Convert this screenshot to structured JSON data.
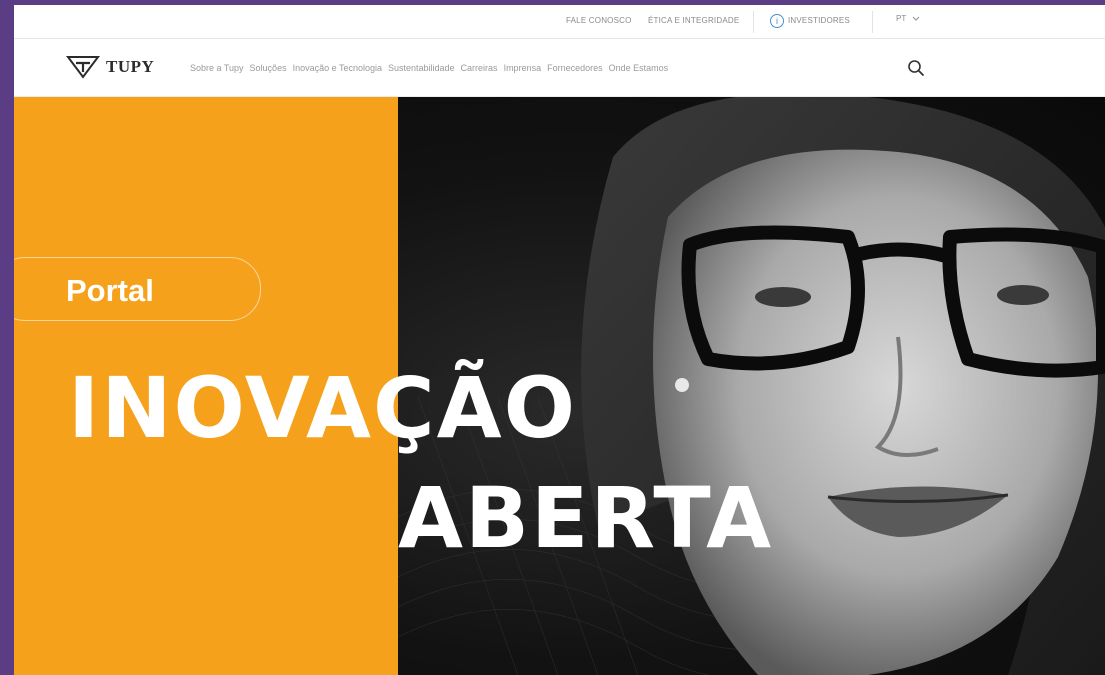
{
  "utility": {
    "links": [
      "FALE CONOSCO",
      "ÉTICA E INTEGRIDADE",
      "INVESTIDORES"
    ],
    "language": "PT",
    "accent_color": "#4a90c9"
  },
  "nav": {
    "logo_text": "TUPY",
    "items": [
      "Sobre a Tupy",
      "Soluções",
      "Inovação e Tecnologia",
      "Sustentabilidade",
      "Carreiras",
      "Imprensa",
      "Fornecedores",
      "Onde Estamos"
    ],
    "search_icon": "search-icon"
  },
  "hero": {
    "portal_label": "Portal",
    "headline_line1": "INOVAÇÃO",
    "headline_line2": "ABERTA",
    "accent_color": "#f5a11c",
    "frame_color": "#5b3d85"
  }
}
